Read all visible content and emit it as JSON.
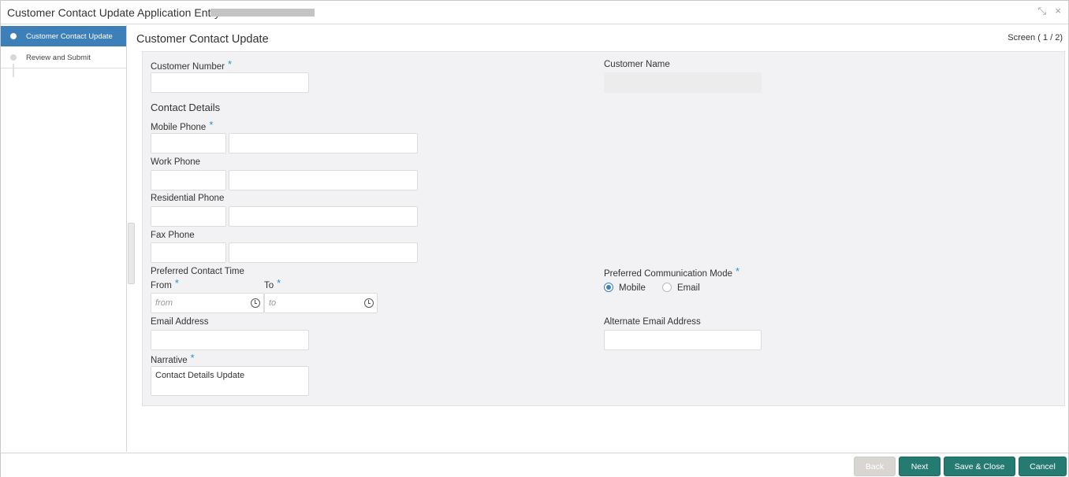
{
  "window": {
    "title": "Customer Contact Update Application Entry -",
    "minimize_glyph": "⤡",
    "close_glyph": "×"
  },
  "sidebar": {
    "steps": [
      {
        "label": "Customer Contact Update",
        "active": true
      },
      {
        "label": "Review and Submit",
        "active": false
      }
    ]
  },
  "main": {
    "title": "Customer Contact Update",
    "screen_indicator": "Screen ( 1 / 2)"
  },
  "form": {
    "customer_number": {
      "label": "Customer Number",
      "required": "*",
      "value": ""
    },
    "customer_name": {
      "label": "Customer Name",
      "value": ""
    },
    "contact_details_heading": "Contact Details",
    "mobile_phone": {
      "label": "Mobile Phone",
      "required": "*"
    },
    "work_phone": {
      "label": "Work Phone"
    },
    "residential_phone": {
      "label": "Residential Phone"
    },
    "fax_phone": {
      "label": "Fax Phone"
    },
    "preferred_contact_time": {
      "label": "Preferred Contact Time",
      "from_label": "From",
      "from_required": "*",
      "from_placeholder": "from",
      "to_label": "To",
      "to_required": "*",
      "to_placeholder": "to"
    },
    "preferred_communication_mode": {
      "label": "Preferred Communication Mode",
      "required": "*",
      "options": [
        "Mobile",
        "Email"
      ],
      "selected": "Mobile"
    },
    "email_address": {
      "label": "Email Address"
    },
    "alternate_email_address": {
      "label": "Alternate Email Address"
    },
    "narrative": {
      "label": "Narrative",
      "required": "*",
      "value": "Contact Details Update"
    }
  },
  "footer": {
    "back": "Back",
    "next": "Next",
    "save_close": "Save & Close",
    "cancel": "Cancel"
  },
  "colors": {
    "accent": "#3d7fb9",
    "button_primary": "#257a72",
    "required_star": "#2a8fd4"
  },
  "icons": {
    "time_picker": "clock-icon",
    "window_restore": "collapse-icon",
    "window_close": "close-icon"
  }
}
